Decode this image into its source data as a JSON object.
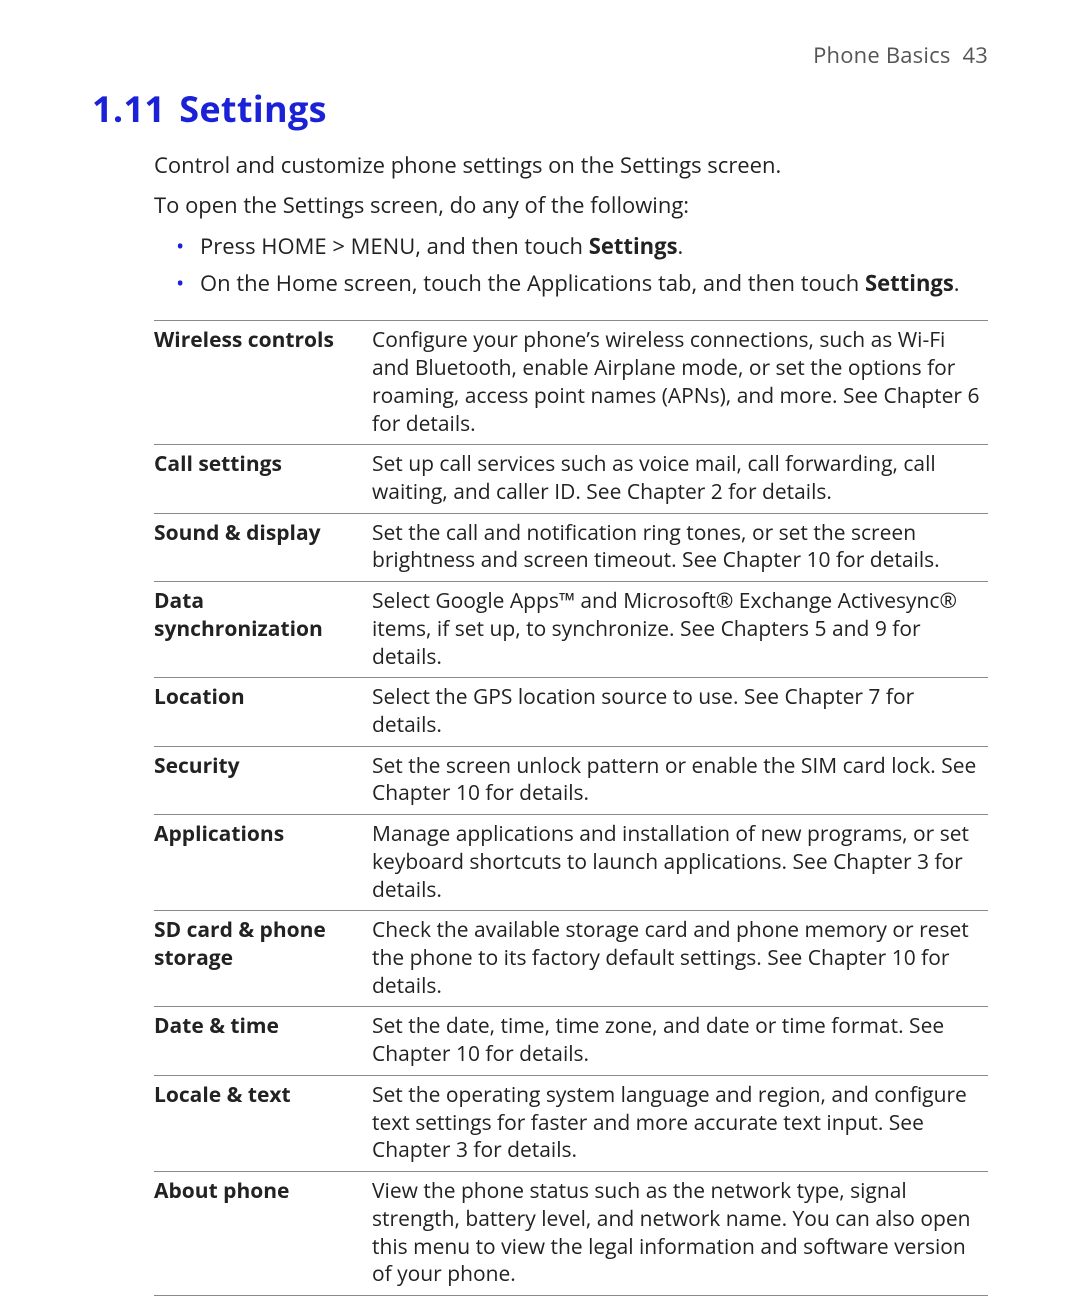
{
  "header": {
    "chapter": "Phone Basics",
    "page": "43"
  },
  "section": {
    "number": "1.11",
    "title": "Settings"
  },
  "intro": {
    "p1": "Control and customize phone settings on the Settings screen.",
    "p2": "To open the Settings screen, do any of the following:"
  },
  "bullets": [
    {
      "pre": "Press HOME > MENU, and then touch ",
      "bold": "Settings",
      "post": "."
    },
    {
      "pre": "On the Home screen, touch the Applications tab, and then touch ",
      "bold": "Settings",
      "post": "."
    }
  ],
  "table": [
    {
      "k": "Wireless controls",
      "v": "Configure your phone’s wireless connections, such as Wi-Fi and Bluetooth, enable Airplane mode, or set the options for roaming, access point names (APNs), and more. See Chapter 6 for details."
    },
    {
      "k": "Call settings",
      "v": "Set up call services such as voice mail, call forwarding, call waiting, and caller ID. See Chapter 2 for details."
    },
    {
      "k": "Sound & display",
      "v": "Set the call and notification ring tones, or set the screen brightness and screen timeout. See Chapter 10 for details."
    },
    {
      "k": "Data synchronization",
      "v": "Select Google Apps™ and Microsoft® Exchange Activesync® items, if set up, to synchronize. See Chapters 5 and 9 for details."
    },
    {
      "k": "Location",
      "v": "Select the GPS location source to use. See Chapter 7 for details."
    },
    {
      "k": "Security",
      "v": "Set the screen unlock pattern or enable the SIM card lock. See Chapter 10 for details."
    },
    {
      "k": "Applications",
      "v": "Manage applications and installation of new programs, or set keyboard shortcuts to launch applications. See Chapter 3 for details."
    },
    {
      "k": "SD card & phone storage",
      "v": "Check the available storage card and phone memory or reset the phone to its factory default settings. See Chapter 10 for details."
    },
    {
      "k": "Date & time",
      "v": "Set the date, time, time zone, and date or time format. See Chapter 10 for details."
    },
    {
      "k": "Locale & text",
      "v": "Set the operating system language and region, and configure text settings for faster and more accurate text input. See Chapter 3 for details."
    },
    {
      "k": "About phone",
      "v": "View the phone status such as the network type, signal strength, battery level, and network name. You can also open this menu to view the legal information and software version of your phone."
    }
  ]
}
